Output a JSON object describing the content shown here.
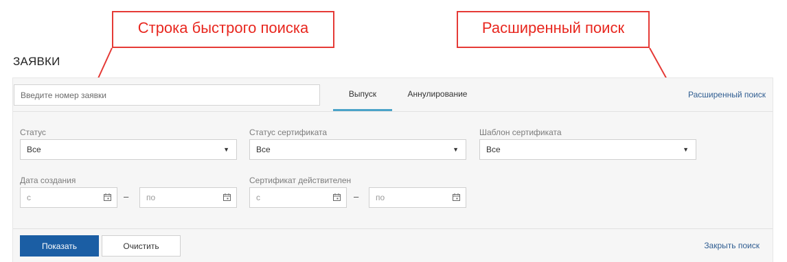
{
  "callouts": {
    "quick_search": "Строка быстрого поиска",
    "advanced_search": "Расширенный поиск"
  },
  "page": {
    "title": "ЗАЯВКИ"
  },
  "topbar": {
    "quick_search_placeholder": "Введите номер заявки",
    "tabs": [
      {
        "label": "Выпуск",
        "active": true
      },
      {
        "label": "Аннулирование",
        "active": false
      }
    ],
    "advanced_search_link": "Расширенный поиск"
  },
  "filters": {
    "status": {
      "label": "Статус",
      "value": "Все"
    },
    "cert_status": {
      "label": "Статус сертификата",
      "value": "Все"
    },
    "cert_template": {
      "label": "Шаблон сертификата",
      "value": "Все"
    },
    "created_date": {
      "label": "Дата создания",
      "from_placeholder": "с",
      "to_placeholder": "по",
      "separator": "–"
    },
    "cert_valid": {
      "label": "Сертификат действителен",
      "from_placeholder": "с",
      "to_placeholder": "по",
      "separator": "–"
    },
    "dropdown_icon": "caret-down-icon",
    "date_icon": "calendar-icon"
  },
  "actions": {
    "show_label": "Показать",
    "clear_label": "Очистить",
    "close_search_label": "Закрыть поиск"
  },
  "colors": {
    "callout": "#e53935",
    "primary": "#1b5ea4",
    "link": "#2f5d91",
    "active_tab": "#4aa3c8",
    "panel_bg": "#f6f6f6"
  }
}
